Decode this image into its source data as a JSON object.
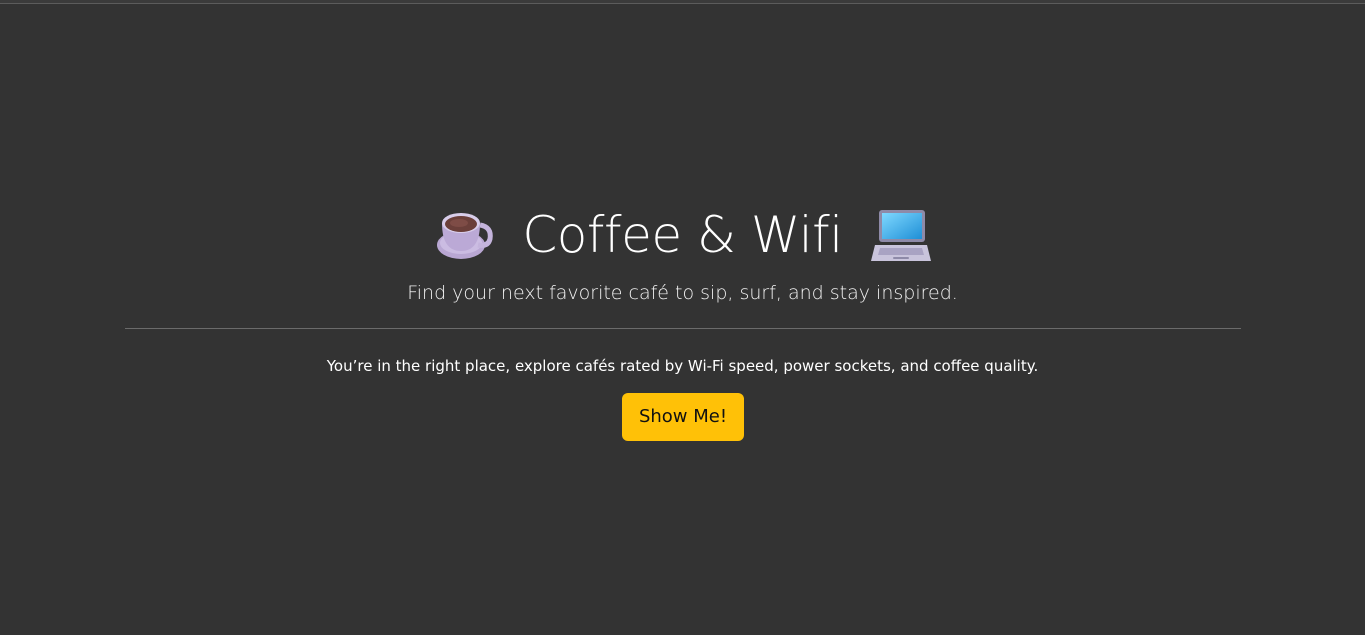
{
  "hero": {
    "title": "Coffee & Wifi",
    "lead": "Find your next favorite café to sip, surf, and stay inspired.",
    "left_icon": "coffee-cup-icon",
    "right_icon": "laptop-icon"
  },
  "main": {
    "body": "You’re in the right place, explore cafés rated by Wi-Fi speed, power sockets, and coffee quality.",
    "cta_label": "Show Me!"
  },
  "colors": {
    "background": "#333333",
    "accent": "#ffc107"
  }
}
